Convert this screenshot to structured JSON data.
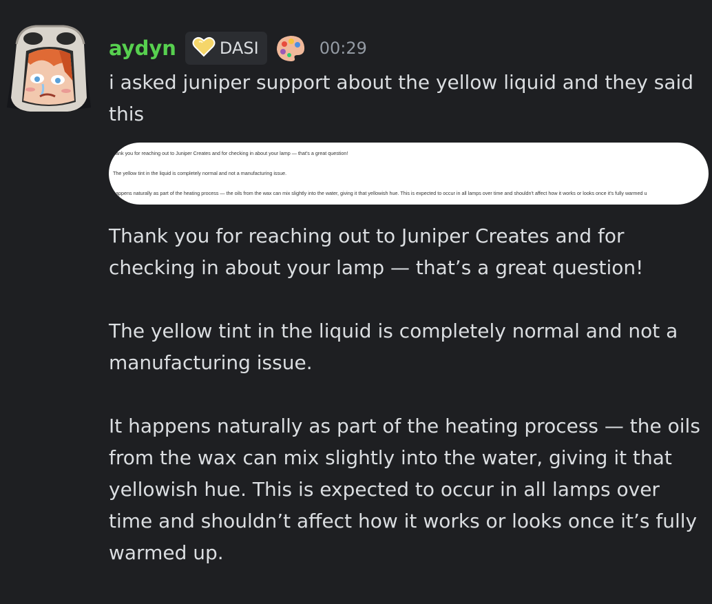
{
  "message": {
    "username": "aydyn",
    "tag": {
      "icon": "heart-badge-icon",
      "label": "DASI"
    },
    "role_icon": "palette-icon",
    "timestamp": "00:29",
    "text": "i asked juniper support about the yellow liquid and they said this",
    "embed_image": {
      "lines": [
        "hank you for reaching out to Juniper Creates and for checking in about your lamp — that's a great question!",
        "The yellow tint in the liquid is completely normal and not a manufacturing issue.",
        "happens naturally as part of the heating process — the oils from the wax can mix slightly into the water, giving it that yellowish hue. This is expected to occur in all lamps over time and shouldn't affect how it works or looks once it's fully warmed u"
      ]
    },
    "paragraphs": [
      "Thank you for reaching out to Juniper Creates and for checking in about your lamp — that’s a great question!",
      "The yellow tint in the liquid is completely normal and not a manufacturing issue.",
      "It happens naturally as part of the heating process — the oils from the wax can mix slightly into the water, giving it that yellowish hue. This is expected to occur in all lamps over time and shouldn’t affect how it works or looks once it’s fully warmed up."
    ]
  },
  "colors": {
    "background": "#1e1f22",
    "username": "#57d04f",
    "text": "#dbdee1",
    "timestamp": "#949ba4",
    "tag_background": "#2b2d31"
  }
}
